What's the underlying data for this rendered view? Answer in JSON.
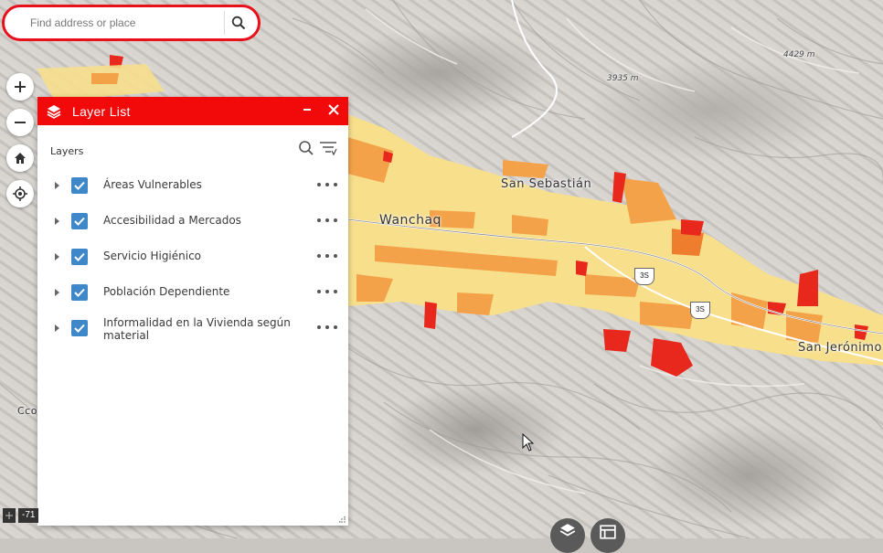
{
  "search": {
    "placeholder": "Find address or place"
  },
  "map": {
    "labels": {
      "wanchaq": "Wanchaq",
      "san_sebastian": "San Sebastián",
      "san_jeronimo": "San Jerónimo",
      "ccorca": "Cco",
      "road_3s_a": "3S",
      "road_3s_b": "3S",
      "elev_a": "3935 m",
      "elev_b": "4429 m"
    },
    "colors": {
      "light_yellow": "#f7df8c",
      "orange": "#f4a24a",
      "dark_orange": "#ee7d2e",
      "red": "#e8281c"
    }
  },
  "coords": {
    "text": "-71"
  },
  "panel": {
    "title": "Layer List",
    "section_label": "Layers",
    "header_color": "#f20a0a",
    "layers": [
      {
        "label": "Áreas Vulnerables",
        "checked": true
      },
      {
        "label": "Accesibilidad a Mercados",
        "checked": true
      },
      {
        "label": "Servicio Higiénico",
        "checked": true
      },
      {
        "label": "Población Dependiente",
        "checked": true
      },
      {
        "label": "Informalidad en la Vivienda según material",
        "checked": true
      }
    ]
  }
}
